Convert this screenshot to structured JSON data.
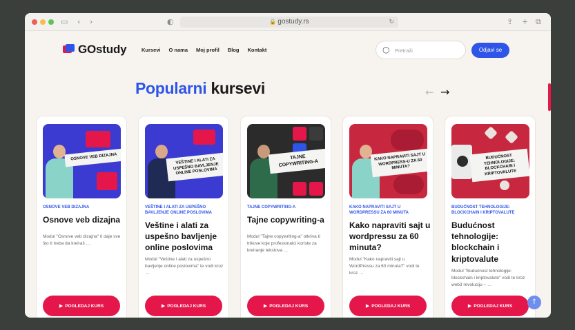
{
  "browser": {
    "url": "gostudy.rs",
    "icons": [
      "sidebar-icon",
      "back-icon",
      "forward-icon",
      "shield-icon",
      "lock-icon",
      "reload-icon",
      "share-icon",
      "new-tab-icon",
      "tabs-icon"
    ]
  },
  "header": {
    "logo_text": "GOstudy",
    "nav": [
      "Kursevi",
      "O nama",
      "Moj profil",
      "Blog",
      "Kontakt"
    ],
    "search_placeholder": "Pretraži",
    "logout_label": "Odjavi se"
  },
  "section": {
    "title_highlight": "Popularni",
    "title_rest": " kursevi"
  },
  "cards": [
    {
      "category": "OSNOVE VEB DIZAJNA",
      "title": "Osnove veb dizajna",
      "description": "Modul \"Osnove veb dizajna\" ti daje sve što ti treba da kreiraš …",
      "thumb_banner": "OSNOVE VEB DIZAJNA",
      "button": "POGLEDAJ KURS"
    },
    {
      "category": "VEŠTINE I ALATI ZA USPEŠNO BAVLJENJE ONLINE POSLOVIMA",
      "title": "Veštine i alati za uspešno bavljenje online poslovima",
      "description": "Modul \"Veštine i alati za uspešno bavljenje online poslovima\" te vodi kroz …",
      "thumb_banner": "VEŠTINE I ALATI ZA USPEŠNO BAVLJENJE ONLINE POSLOVIMA",
      "button": "POGLEDAJ KURS"
    },
    {
      "category": "TAJNE COPYWRITING-A",
      "title": "Tajne copywriting-a",
      "description": "Modul \"Tajne copywriting-a\" otkriva ti trikove koje profesionalci koriste za kreiranje tekstova …",
      "thumb_banner": "TAJNE COPYWRITING-A",
      "button": "POGLEDAJ KURS"
    },
    {
      "category": "KAKO NAPRAVITI SAJT U WORDPRESSU ZA 60 MINUTA",
      "title": "Kako napraviti sajt u wordpressu za 60 minuta?",
      "description": "Modul \"Kako napraviti sajt u WordPressu za 60 minuta?\" vodi te kroz …",
      "thumb_banner": "KAKO NAPRAVITI SAJT U WORDPRESS-U ZA 60 MINUTA?",
      "button": "POGLEDAJ KURS"
    },
    {
      "category": "BUDUĆNOST TEHNOLOGIJE: BLOCKCHAIN I KRIPTOVALUTE",
      "title": "Budućnost tehnologije: blockchain i kriptovalute",
      "description": "Modul \"Budućnost tehnologije: blockchain i kriptovalute\" vodi te kroz web3 revoluciju – …",
      "thumb_banner": "BUDUĆNOST TEHNOLOGIJE: BLOCKCHAIN I KRIPTOVALUTE",
      "button": "POGLEDAJ KURS"
    }
  ],
  "colors": {
    "brand_blue": "#2f55e8",
    "brand_red": "#e5174a",
    "page_bg": "#f7f4ef"
  }
}
